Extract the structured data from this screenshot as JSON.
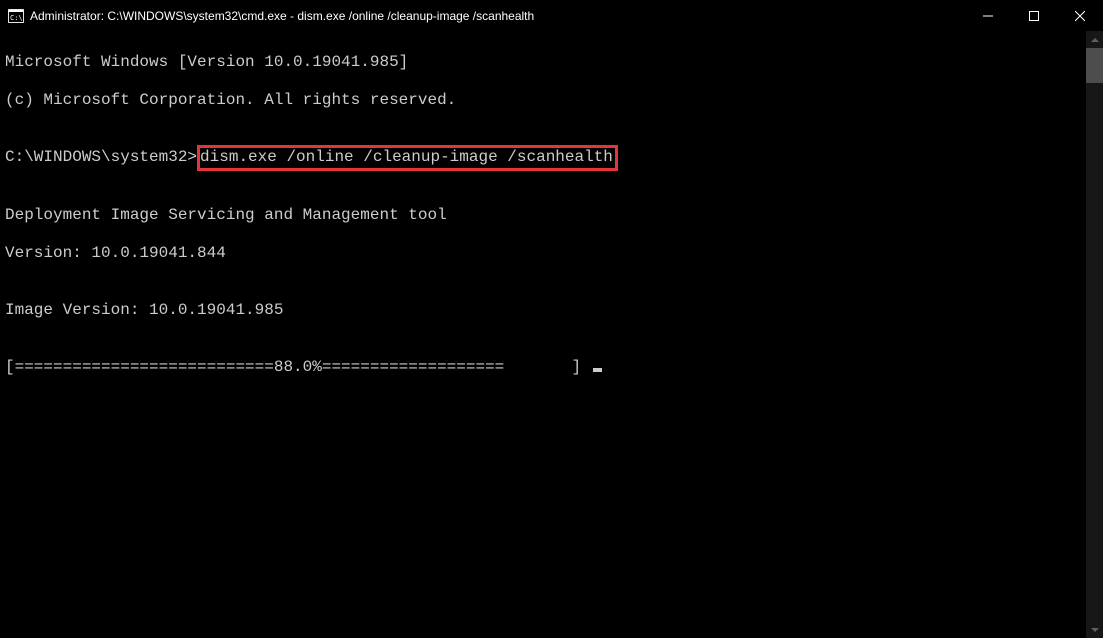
{
  "window": {
    "title": "Administrator: C:\\WINDOWS\\system32\\cmd.exe - dism.exe  /online /cleanup-image /scanhealth"
  },
  "terminal": {
    "line_os": "Microsoft Windows [Version 10.0.19041.985]",
    "line_copyright": "(c) Microsoft Corporation. All rights reserved.",
    "blank": "",
    "prompt_path": "C:\\WINDOWS\\system32>",
    "prompt_command": "dism.exe /online /cleanup-image /scanhealth",
    "tool_name": "Deployment Image Servicing and Management tool",
    "tool_version": "Version: 10.0.19041.844",
    "image_version": "Image Version: 10.0.19041.985",
    "progress": "[===========================88.0%===================       ] "
  }
}
